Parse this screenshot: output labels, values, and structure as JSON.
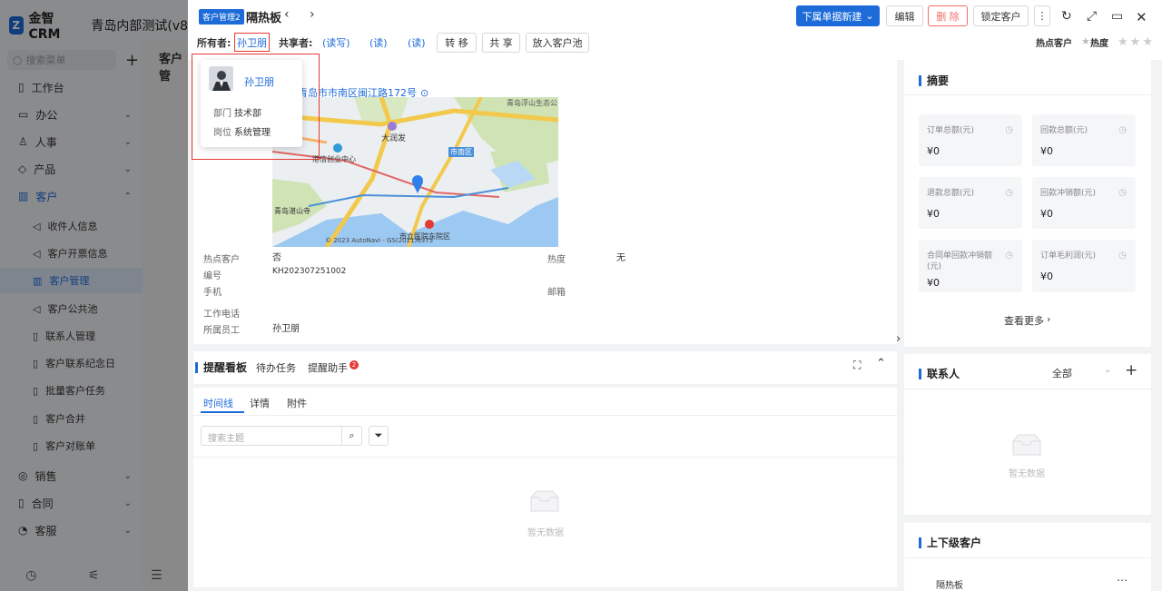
{
  "sidebar": {
    "brand": "金智CRM",
    "tenant": "青岛内部测试(v8",
    "search_placeholder": "搜索菜单",
    "items": [
      {
        "label": "工作台",
        "icon": "desk-icon"
      },
      {
        "label": "办公",
        "icon": "office-icon"
      },
      {
        "label": "人事",
        "icon": "people-icon"
      },
      {
        "label": "产品",
        "icon": "box-icon"
      },
      {
        "label": "客户",
        "icon": "chart-icon"
      }
    ],
    "sub_items": [
      "收件人信息",
      "客户开票信息",
      "客户管理",
      "客户公共池",
      "联系人管理",
      "客户联系纪念日",
      "批量客户任务",
      "客户合并",
      "客户对账单"
    ],
    "items_after": [
      {
        "label": "销售"
      },
      {
        "label": "合同"
      },
      {
        "label": "客服"
      }
    ],
    "behind_title": "客户管"
  },
  "header": {
    "tag": "客户管理2",
    "title": "隔热板",
    "new_dropdown": "下属单据新建",
    "edit": "编辑",
    "delete": "删 除",
    "lock": "锁定客户",
    "owner_label": "所有者:",
    "owner_name": "孙卫朋",
    "share_label": "共享者:",
    "share_links": [
      "(读写)",
      "(读)",
      "(读)"
    ],
    "transfer": "转 移",
    "share": "共 享",
    "to_pool": "放入客户池",
    "hot_label": "热点客户",
    "heat_label": "热度"
  },
  "popup": {
    "name": "孙卫朋",
    "dept_label": "部门",
    "dept_value": "技术部",
    "post_label": "岗位",
    "post_value": "系统管理"
  },
  "map": {
    "address": "青岛市市南区闽江路172号",
    "labels": [
      "青岛浮山生态公",
      "大润发",
      "港信创业中心",
      "市南区",
      "青岛湛山寺",
      "市立医院东院区"
    ],
    "copyright": "© 2023 AutoNavi - GS(2021)6375"
  },
  "info": {
    "hot_label": "热点客户",
    "hot_value": "否",
    "heat_label": "热度",
    "heat_value": "无",
    "code_label": "编号",
    "code_value": "KH202307251002",
    "mobile_label": "手机",
    "email_label": "邮箱",
    "phone_label": "工作电话",
    "staff_label": "所属员工",
    "staff_value": "孙卫朋"
  },
  "reminder": {
    "title": "提醒看板",
    "tab_todo": "待办任务",
    "tab_helper": "提醒助手",
    "helper_badge": "2",
    "subtabs": [
      "时间线",
      "详情",
      "附件"
    ],
    "search_placeholder": "搜索主题",
    "empty": "暂无数据"
  },
  "summary": {
    "title": "摘要",
    "boxes": [
      {
        "label": "订单总额(元)",
        "value": "¥0"
      },
      {
        "label": "回款总额(元)",
        "value": "¥0"
      },
      {
        "label": "退款总额(元)",
        "value": "¥0"
      },
      {
        "label": "回款冲销额(元)",
        "value": "¥0"
      },
      {
        "label": "合同单回款冲销额(元)",
        "value": "¥0"
      },
      {
        "label": "订单毛利润(元)",
        "value": "¥0"
      }
    ],
    "more": "查看更多"
  },
  "contacts": {
    "title": "联系人",
    "filter": "全部",
    "empty": "暂无数据"
  },
  "parent_child": {
    "title": "上下级客户",
    "item": "隔热板"
  },
  "colors": {
    "accent": "#1d6bd8",
    "danger": "#e53935"
  }
}
